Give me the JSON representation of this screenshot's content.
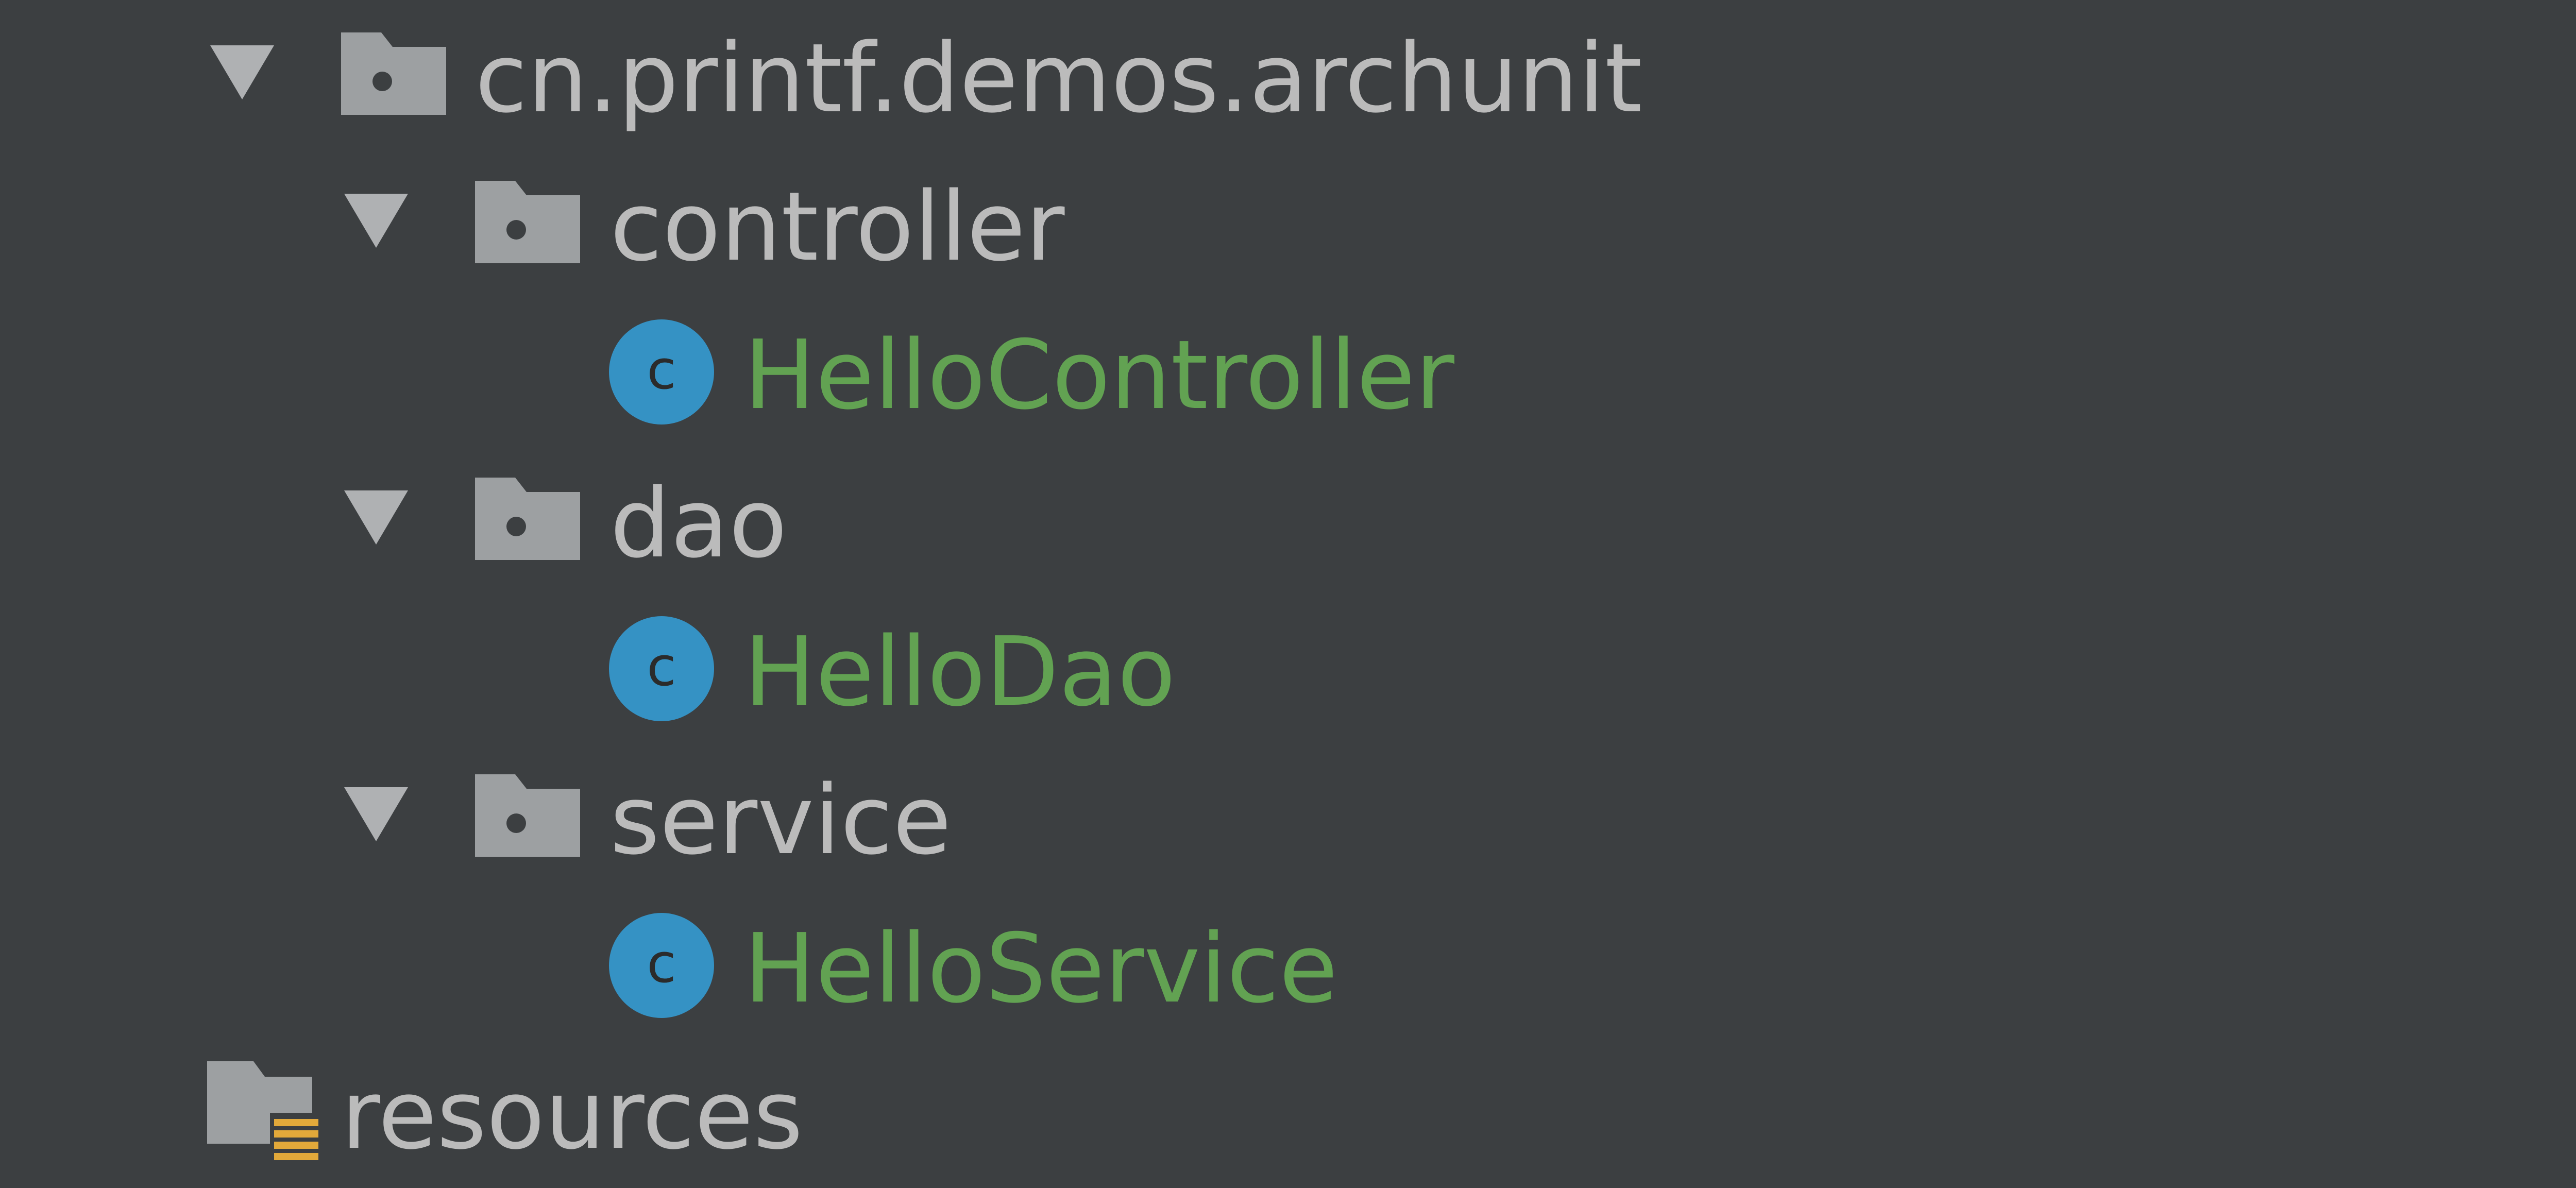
{
  "colors": {
    "background": "#3c3f41",
    "text": "#bbbbbb",
    "class_text": "#62a252",
    "folder_icon": "#9da0a2",
    "class_icon": "#3592c4",
    "resources_badge": "#e2a93a"
  },
  "tree": {
    "root_package": {
      "label": "cn.printf.demos.archunit",
      "icon": "package-folder-icon",
      "expanded": true
    },
    "packages": [
      {
        "label": "controller",
        "icon": "package-folder-icon",
        "expanded": true,
        "classes": [
          {
            "label": "HelloController",
            "icon": "class-icon"
          }
        ]
      },
      {
        "label": "dao",
        "icon": "package-folder-icon",
        "expanded": true,
        "classes": [
          {
            "label": "HelloDao",
            "icon": "class-icon"
          }
        ]
      },
      {
        "label": "service",
        "icon": "package-folder-icon",
        "expanded": true,
        "classes": [
          {
            "label": "HelloService",
            "icon": "class-icon"
          }
        ]
      }
    ],
    "resources": {
      "label": "resources",
      "icon": "resources-folder-icon"
    }
  }
}
